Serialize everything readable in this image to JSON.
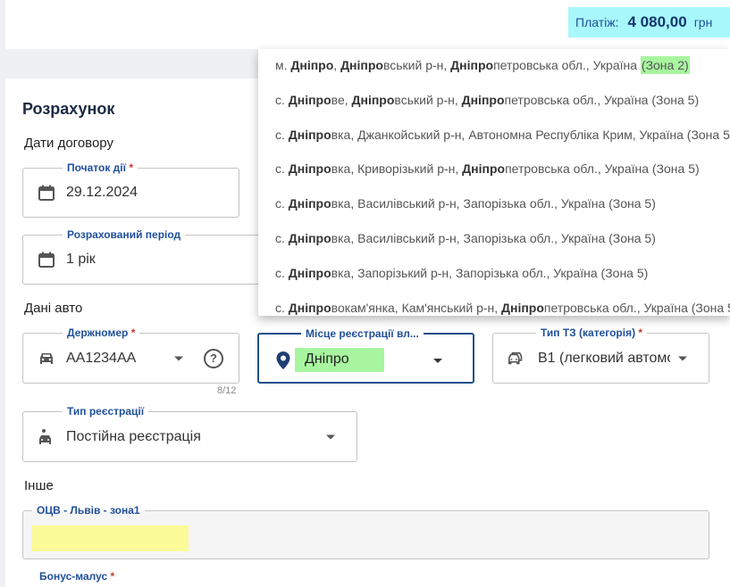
{
  "header": {
    "payment_label": "Платіж:",
    "payment_amount": "4 080,00",
    "payment_currency": "грн"
  },
  "calc": {
    "title": "Розрахунок",
    "contract_section": "Дати договору",
    "start_label": "Початок дії",
    "start_value": "29.12.2024",
    "period_label": "Розрахований період",
    "period_value": "1 рік",
    "car_section": "Дані авто",
    "plate_label": "Держномер",
    "plate_value": "AA1234AA",
    "plate_counter": "8/12",
    "place_label": "Місце реєстрації вл...",
    "place_value": "Дніпро",
    "type_label": "Тип ТЗ (категорія)",
    "type_value": "B1 (легковий автомо",
    "regtype_label": "Тип реєстрації",
    "regtype_value": "Постійна реєстрація",
    "other_section": "Інше",
    "ocv_label": "ОЦВ - Львів - зона1",
    "required_mark": "*",
    "bottom_label": "Бонус-малус"
  },
  "dropdown": {
    "options": [
      {
        "parts": [
          [
            "м. ",
            0
          ],
          [
            "Дніпро",
            1
          ],
          [
            ", ",
            0
          ],
          [
            "Дніпро",
            1
          ],
          [
            "вський р-н, ",
            0
          ],
          [
            "Дніпро",
            1
          ],
          [
            "петровська обл., Україна ",
            0
          ]
        ],
        "zone": "(Зона 2)"
      },
      {
        "parts": [
          [
            "с. ",
            0
          ],
          [
            "Дніпро",
            1
          ],
          [
            "ве, ",
            0
          ],
          [
            "Дніпро",
            1
          ],
          [
            "вський р-н, ",
            0
          ],
          [
            "Дніпро",
            1
          ],
          [
            "петровська обл., Україна (Зона 5)",
            0
          ]
        ]
      },
      {
        "parts": [
          [
            "с. ",
            0
          ],
          [
            "Дніпро",
            1
          ],
          [
            "вка, Джанкойський р-н, Автономна Республіка Крим, Україна (Зона 5",
            0
          ]
        ]
      },
      {
        "parts": [
          [
            "с. ",
            0
          ],
          [
            "Дніпро",
            1
          ],
          [
            "вка, Криворізький р-н, ",
            0
          ],
          [
            "Дніпро",
            1
          ],
          [
            "петровська обл., Україна (Зона 5)",
            0
          ]
        ]
      },
      {
        "parts": [
          [
            "с. ",
            0
          ],
          [
            "Дніпро",
            1
          ],
          [
            "вка, Василівський р-н, Запорізька обл., Україна (Зона 5)",
            0
          ]
        ]
      },
      {
        "parts": [
          [
            "с. ",
            0
          ],
          [
            "Дніпро",
            1
          ],
          [
            "вка, Василівський р-н, Запорізька обл., Україна (Зона 5)",
            0
          ]
        ]
      },
      {
        "parts": [
          [
            "с. ",
            0
          ],
          [
            "Дніпро",
            1
          ],
          [
            "вка, Запорізький р-н, Запорізька обл., Україна (Зона 5)",
            0
          ]
        ]
      },
      {
        "parts": [
          [
            "с. ",
            0
          ],
          [
            "Дніпро",
            1
          ],
          [
            "вокам'янка, Кам'янський р-н, ",
            0
          ],
          [
            "Дніпро",
            1
          ],
          [
            "петровська обл., Україна (Зона 5",
            0
          ]
        ]
      }
    ]
  },
  "colors": {
    "accent": "#1f4f9a",
    "highlight_cyan": "#a8f7fb",
    "highlight_green": "#a8f5a0",
    "highlight_yellow": "#fbfb9a"
  }
}
